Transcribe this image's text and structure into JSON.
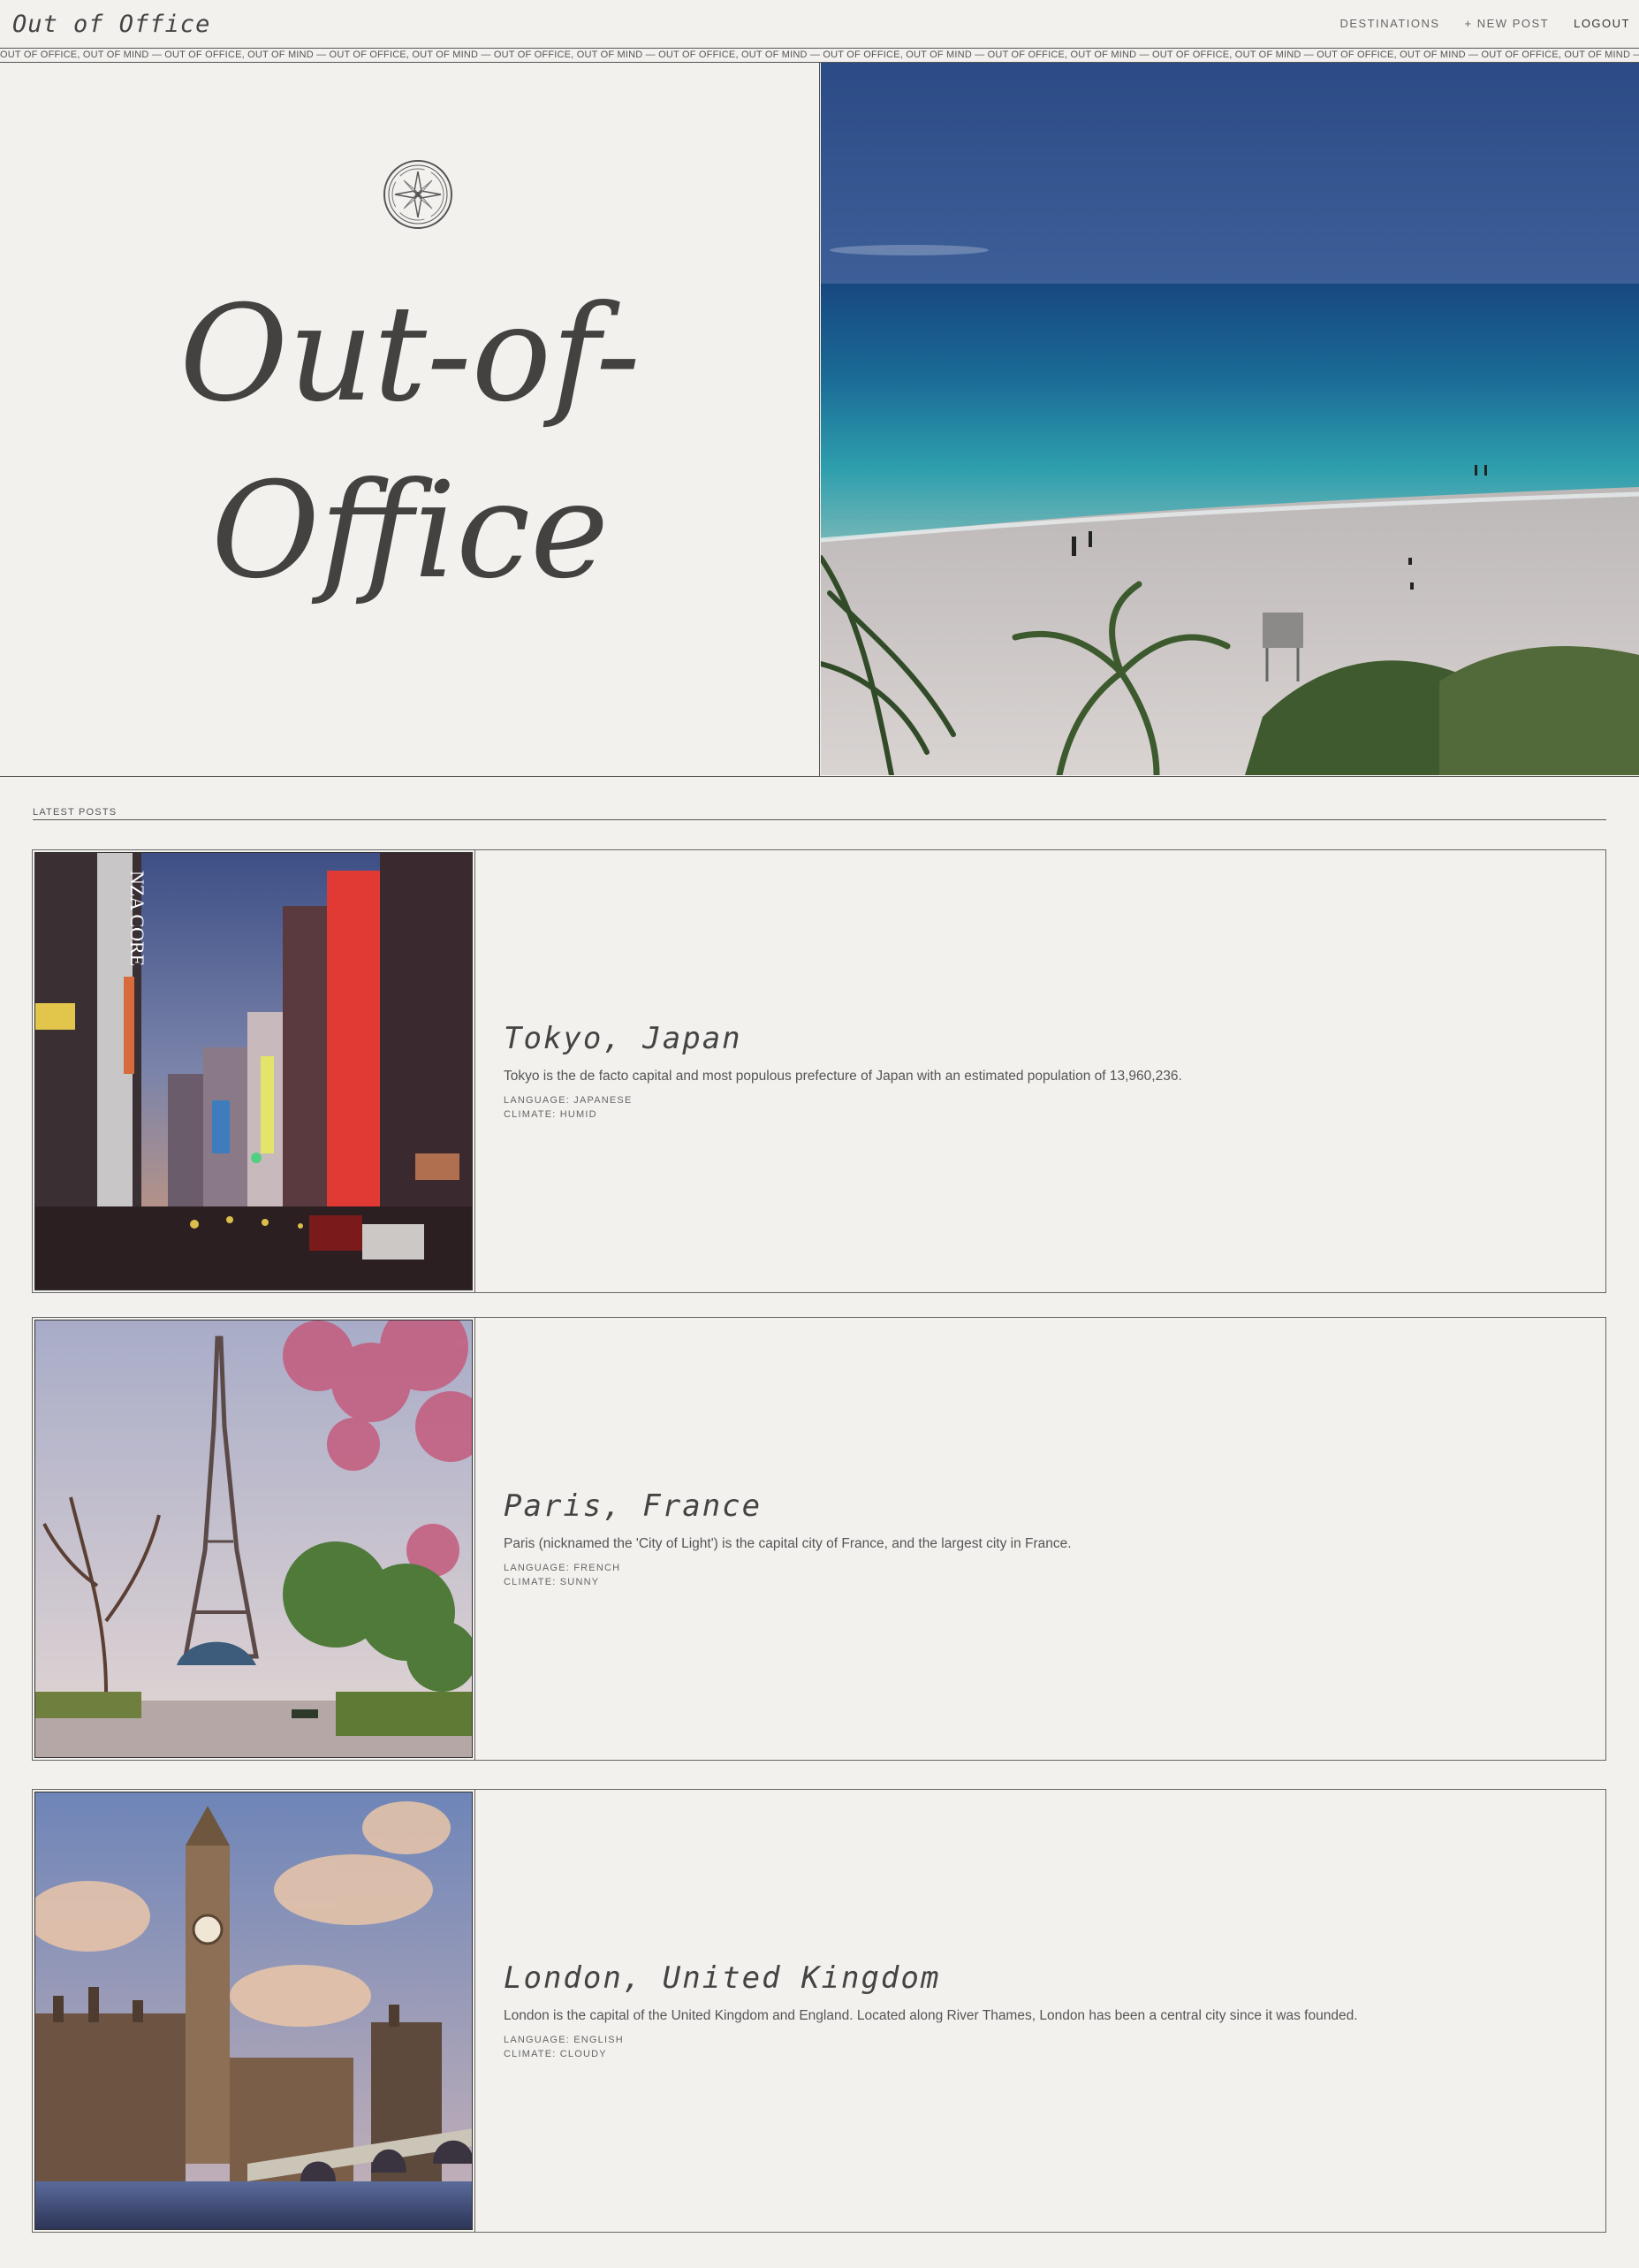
{
  "header": {
    "brand": "Out of Office",
    "nav": {
      "destinations": "DESTINATIONS",
      "new_post": "+ NEW POST",
      "logout": "LOGOUT"
    }
  },
  "marquee": {
    "text": "OUT OF OFFICE, OUT OF MIND — OUT OF OFFICE, OUT OF MIND — OUT OF OFFICE, OUT OF MIND — OUT OF OFFICE, OUT OF MIND — OUT OF OFFICE, OUT OF MIND — OUT OF OFFICE, OUT OF MIND — OUT OF OFFICE, OUT OF MIND — OUT OF OFFICE, OUT OF MIND — OUT OF OFFICE, OUT OF MIND — OUT OF OFFICE, OUT OF MIND — OUT OF OFFICE, OUT OF MIND — OUT OF OFFICE, OUT OF MIND — OUT OF OFFICE, OUT OF MIND — OUT OF OFFICE, OUT OF MIND"
  },
  "hero": {
    "title_line1": "Out-of-",
    "title_line2": "Office",
    "logo_icon": "compass-icon",
    "image": "beach-photo"
  },
  "latest": {
    "label": "LATEST POSTS"
  },
  "posts": [
    {
      "title": "Tokyo, Japan",
      "description": "Tokyo is the de facto capital and most populous prefecture of Japan with an estimated population of 13,960,236.",
      "language": "LANGUAGE: JAPANESE",
      "climate": "CLIMATE: HUMID",
      "image": "tokyo-street-photo"
    },
    {
      "title": "Paris, France",
      "description": "Paris (nicknamed the 'City of Light') is the capital city of France, and the largest city in France.",
      "language": "LANGUAGE: FRENCH",
      "climate": "CLIMATE: SUNNY",
      "image": "eiffel-tower-photo"
    },
    {
      "title": "London, United Kingdom",
      "description": "London is the capital of the United Kingdom and England. Located along River Thames, London has been a central city since it was founded.",
      "language": "LANGUAGE: ENGLISH",
      "climate": "CLIMATE: CLOUDY",
      "image": "big-ben-photo"
    }
  ],
  "colors": {
    "background": "#f2f1ee",
    "text": "#444444",
    "rule": "#555555"
  }
}
